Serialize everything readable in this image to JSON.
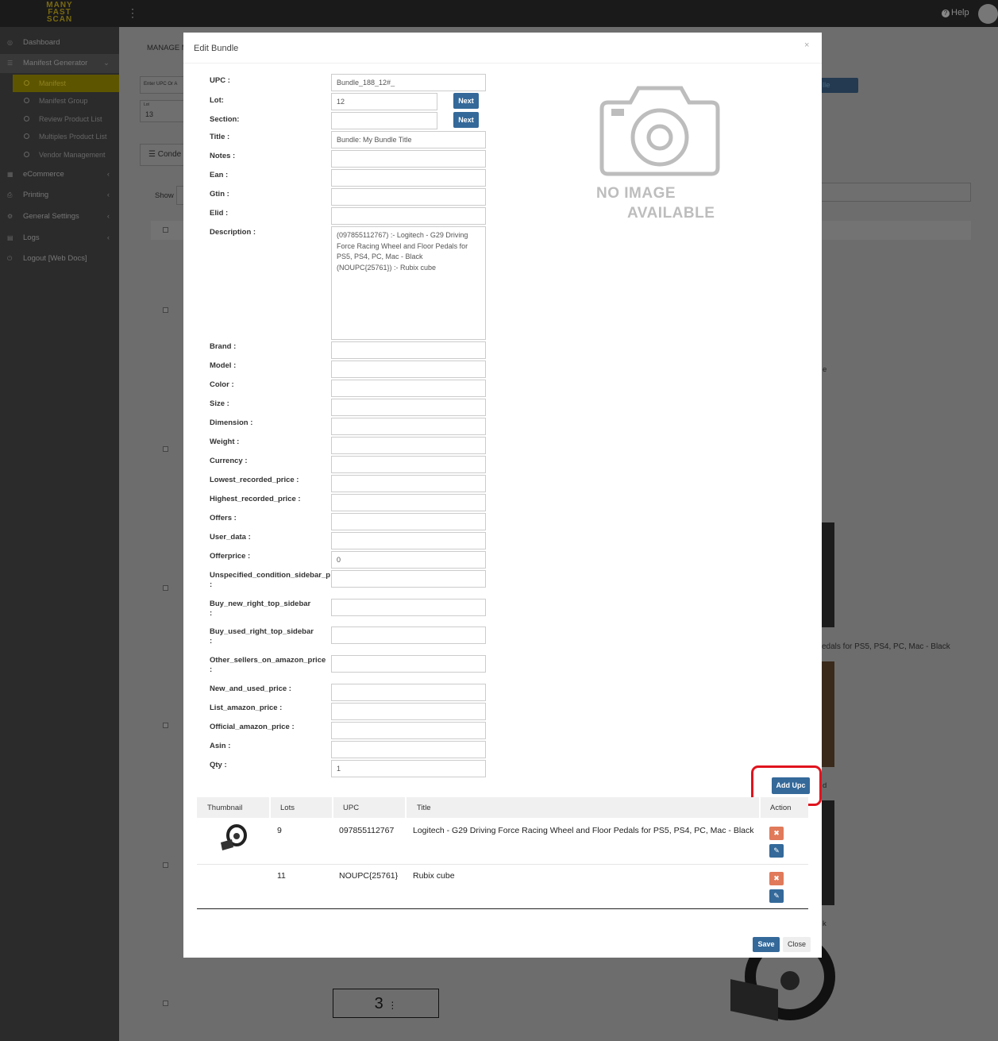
{
  "app": {
    "logo": [
      "MANY",
      "FAST",
      "SCAN"
    ],
    "help_label": "Help"
  },
  "sidebar": {
    "items": [
      {
        "label": "Dashboard"
      },
      {
        "label": "Manifest Generator"
      },
      {
        "label": "eCommerce"
      },
      {
        "label": "Printing"
      },
      {
        "label": "General Settings"
      },
      {
        "label": "Logs"
      },
      {
        "label": "Logout [Web Docs]"
      }
    ],
    "sub_items": [
      {
        "label": "Manifest"
      },
      {
        "label": "Manifest Group"
      },
      {
        "label": "Review Product List"
      },
      {
        "label": "Multiples Product List"
      },
      {
        "label": "Vendor Management"
      }
    ]
  },
  "background": {
    "manage_label": "MANAGE M",
    "upc_placeholder": "Enter UPC Or A",
    "lot_small": "Lot",
    "lot_value": "13",
    "condense_label": "Conde",
    "show_label": "Show",
    "btn_partial": "lle",
    "row_tail_1": "e",
    "row_tail_2": "edals for PS5, PS4, PC, Mac - Black",
    "row_tail_3": "d",
    "row_tail_4": "k",
    "page_number": "3"
  },
  "modal": {
    "title": "Edit Bundle",
    "close_symbol": "×",
    "next_label": "Next",
    "fields": {
      "upc": {
        "label": "UPC :",
        "value": "Bundle_188_12#_"
      },
      "lot": {
        "label": "Lot:",
        "value": "12"
      },
      "section": {
        "label": "Section:",
        "value": ""
      },
      "title": {
        "label": "Title :",
        "value": "Bundle: My Bundle Title"
      },
      "notes": {
        "label": "Notes :",
        "value": ""
      },
      "ean": {
        "label": "Ean :",
        "value": ""
      },
      "gtin": {
        "label": "Gtin :",
        "value": ""
      },
      "elid": {
        "label": "Elid :",
        "value": ""
      },
      "description": {
        "label": "Description :",
        "value": "(097855112767) :- Logitech - G29 Driving Force Racing Wheel and Floor Pedals for PS5, PS4, PC, Mac - Black\n(NOUPC{25761}) :- Rubix cube"
      },
      "brand": {
        "label": "Brand :",
        "value": ""
      },
      "model": {
        "label": "Model :",
        "value": ""
      },
      "color": {
        "label": "Color :",
        "value": ""
      },
      "size": {
        "label": "Size :",
        "value": ""
      },
      "dimension": {
        "label": "Dimension :",
        "value": ""
      },
      "weight": {
        "label": "Weight :",
        "value": ""
      },
      "currency": {
        "label": "Currency :",
        "value": ""
      },
      "lowest_recorded_price": {
        "label": "Lowest_recorded_price :",
        "value": ""
      },
      "highest_recorded_price": {
        "label": "Highest_recorded_price :",
        "value": ""
      },
      "offers": {
        "label": "Offers :",
        "value": ""
      },
      "user_data": {
        "label": "User_data :",
        "value": ""
      },
      "offerprice": {
        "label": "Offerprice :",
        "value": "0"
      },
      "unspecified_condition": {
        "label": "Unspecified_condition_sidebar_p",
        "label_suffix": ":",
        "value": ""
      },
      "buy_new": {
        "label": "Buy_new_right_top_sidebar",
        "label_suffix": ":",
        "value": ""
      },
      "buy_used": {
        "label": "Buy_used_right_top_sidebar",
        "label_suffix": ":",
        "value": ""
      },
      "other_sellers": {
        "label": "Other_sellers_on_amazon_price",
        "label_suffix": ":",
        "value": ""
      },
      "new_and_used": {
        "label": "New_and_used_price :",
        "value": ""
      },
      "list_amazon": {
        "label": "List_amazon_price :",
        "value": ""
      },
      "official_amazon": {
        "label": "Official_amazon_price :",
        "value": ""
      },
      "asin": {
        "label": "Asin :",
        "value": ""
      },
      "qty": {
        "label": "Qty :",
        "value": "1"
      }
    },
    "no_image": {
      "line1": "NO IMAGE",
      "line2": "AVAILABLE"
    },
    "add_upc_label": "Add Upc",
    "table": {
      "headers": [
        "Thumbnail",
        "Lots",
        "UPC",
        "Title",
        "Action"
      ],
      "rows": [
        {
          "lots": "9",
          "upc": "097855112767",
          "title": "Logitech - G29 Driving Force Racing Wheel and Floor Pedals for PS5, PS4, PC, Mac - Black",
          "has_thumb": true
        },
        {
          "lots": "11",
          "upc": "NOUPC{25761}",
          "title": "Rubix cube",
          "has_thumb": false
        }
      ],
      "delete_symbol": "✖",
      "edit_symbol": "✎"
    },
    "save_label": "Save",
    "close_label": "Close"
  },
  "colors": {
    "primary_button": "#34699a",
    "danger_button": "#e07a5a",
    "highlight_ring": "#e0141e"
  }
}
